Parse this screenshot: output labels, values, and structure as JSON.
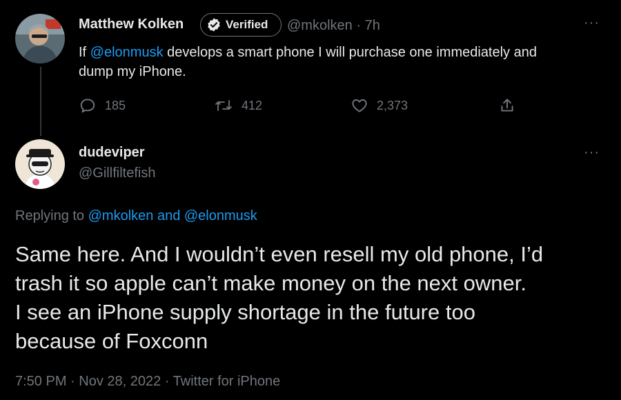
{
  "tweet1": {
    "display_name": "Matthew Kolken",
    "verified_label": "Verified",
    "handle": "@mkolken",
    "separator": "·",
    "time_ago": "7h",
    "text_prefix": "If ",
    "mention": "@elonmusk",
    "text_line1_rest": " develops a smart phone I will purchase one immediately and",
    "text_line2": "dump my iPhone.",
    "replies": "185",
    "retweets": "412",
    "likes": "2,373",
    "more": "···"
  },
  "tweet2": {
    "display_name": "dudeviper",
    "handle": "@Gillfiltefish",
    "more": "···",
    "replying_prefix": "Replying to ",
    "replying_to": "@mkolken and @elonmusk",
    "text_lines": [
      "Same here. And I wouldn’t even resell my old phone, I’d",
      "trash it so apple can’t make money on the next owner.",
      "I see an iPhone supply shortage in the future too",
      "because of Foxconn"
    ],
    "timestamp": "7:50 PM · Nov 28, 2022 · Twitter for iPhone"
  },
  "icons": {
    "reply": "reply-icon",
    "retweet": "retweet-icon",
    "like": "heart-icon",
    "share": "share-icon",
    "verified": "verified-badge-icon"
  },
  "colors": {
    "background": "#000000",
    "text": "#e7e9ea",
    "muted": "#71767b",
    "link": "#1d9bf0"
  }
}
